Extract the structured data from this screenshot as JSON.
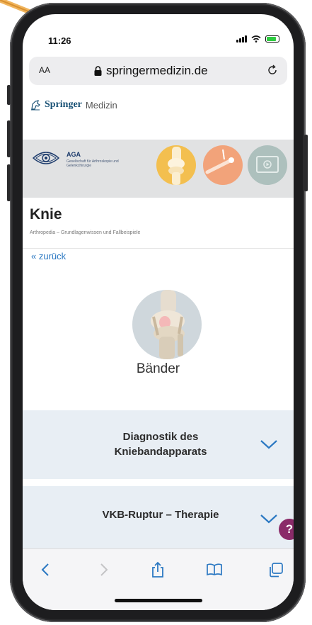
{
  "status_bar": {
    "time": "11:26",
    "battery_level": 0.8
  },
  "browser": {
    "text_size_label": "AA",
    "url": "springermedizin.de"
  },
  "springer": {
    "brand": "Springer",
    "sub": "Medizin"
  },
  "banner": {
    "org": "AGA",
    "org_sub": "Gesellschaft für Arthroskopie und Gelenkchirurgie"
  },
  "page": {
    "title": "Knie",
    "subtitle": "Arthropedia – Grundlagenwissen und Fallbeispiele",
    "back": "« zurück"
  },
  "topic": {
    "label": "Bänder"
  },
  "accordions": [
    {
      "label": "Diagnostik des Kniebandapparats"
    },
    {
      "label": "VKB-Ruptur – Therapie"
    }
  ],
  "help": {
    "label": "?"
  },
  "colors": {
    "accent": "#2b78c2",
    "accordion_bg": "#e8eef4",
    "help_badge": "#8a2b69",
    "annotation": "#e8a44a"
  },
  "icons": {
    "lock": "lock-icon",
    "reload": "reload-icon",
    "back": "chevron-left-icon",
    "forward": "chevron-right-icon",
    "share": "share-icon",
    "bookmarks": "book-icon",
    "tabs": "tabs-icon",
    "expand": "chevron-down-icon"
  }
}
